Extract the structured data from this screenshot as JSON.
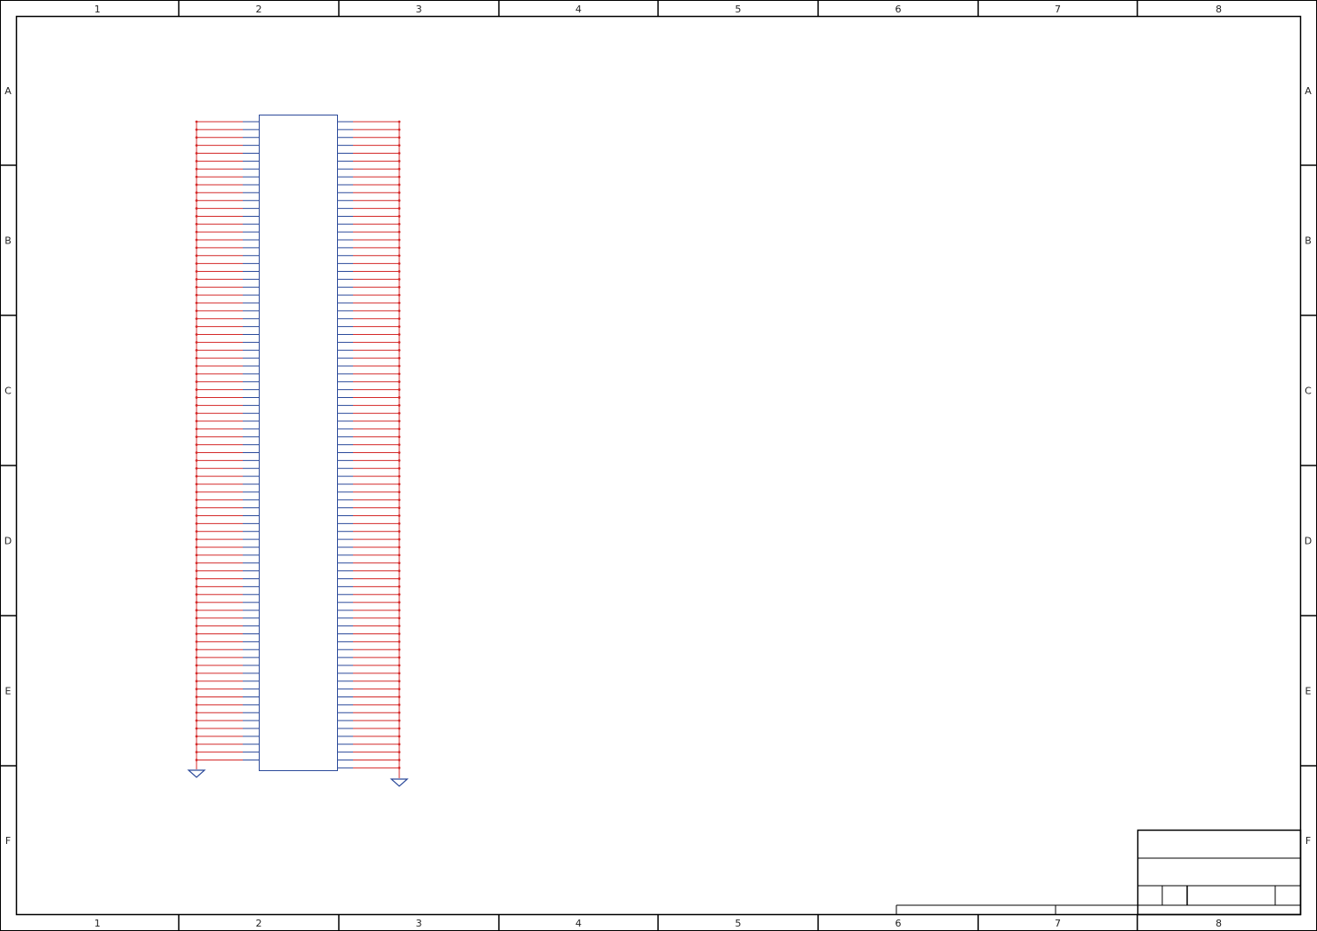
{
  "frame": {
    "columns": [
      "1",
      "2",
      "3",
      "4",
      "5",
      "6",
      "7",
      "8"
    ],
    "rows": [
      "A",
      "B",
      "C",
      "D",
      "E",
      "F"
    ]
  },
  "schematic": {
    "wire_color": "#d42a2a",
    "pin_color": "#2c4a9a",
    "frame_color": "#000000",
    "left_pin_count": 82,
    "right_pin_count": 83,
    "left_ground_count": 1,
    "right_ground_count": 1
  },
  "title_block": {
    "lines_present": true
  }
}
